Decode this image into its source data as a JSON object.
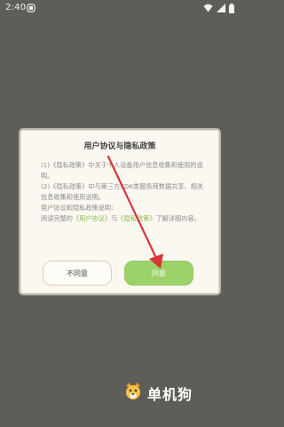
{
  "status_bar": {
    "time": "2:40"
  },
  "dialog": {
    "title": "用户协议与隐私政策",
    "para1": "(1)《隐私政策》中关于个人设备用户信息收集和使用的说明。",
    "para2": "(2)《隐私政策》中与第三方SDK类服务商数据共享、相关信息收集和使用说明。",
    "para3_prefix": "用户协议和隐私政策说明：",
    "para4_a": "阅读完整的",
    "link_user_agreement": "《用户协议》",
    "para4_b": "与",
    "link_privacy_policy": "《隐私政策》",
    "para4_c": "了解详细内容。",
    "reject_label": "不同意",
    "agree_label": "同意"
  },
  "watermark": {
    "text": "单机狗"
  },
  "colors": {
    "background": "#5f5d57",
    "dialog_bg": "#fbf8f1",
    "accent_green": "#9bd26a",
    "link_green": "#8ab84f",
    "arrow_red": "#d8333a"
  }
}
